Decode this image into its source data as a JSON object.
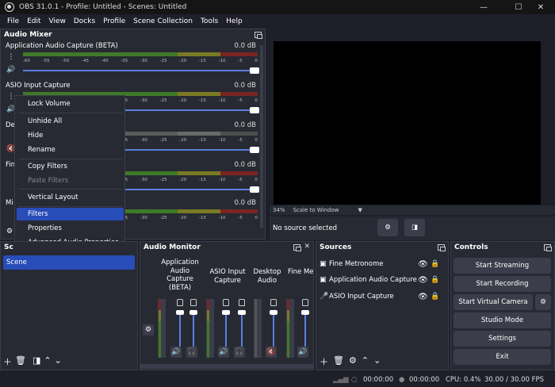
{
  "window": {
    "title": "OBS 31.0.1 - Profile: Untitled - Scenes: Untitled"
  },
  "menu": [
    "File",
    "Edit",
    "View",
    "Docks",
    "Profile",
    "Scene Collection",
    "Tools",
    "Help"
  ],
  "audio_mixer": {
    "title": "Audio Mixer",
    "ticks": [
      "-60",
      "-55",
      "-50",
      "-45",
      "-40",
      "-35",
      "-30",
      "-25",
      "-20",
      "-15",
      "-10",
      "-5",
      "0"
    ],
    "channels": [
      {
        "name": "Application Audio Capture (BETA)",
        "db": "0.0 dB"
      },
      {
        "name": "ASIO Input Capture",
        "db": "0.0 dB"
      },
      {
        "name": "De",
        "db": "0.0 dB"
      },
      {
        "name": "Fin",
        "db": "0.0 dB"
      },
      {
        "name": "Mi",
        "db": "0.0 dB"
      }
    ]
  },
  "context_menu": {
    "items": [
      {
        "label": "Lock Volume",
        "state": "normal"
      },
      {
        "label": "Unhide All",
        "state": "normal"
      },
      {
        "label": "Hide",
        "state": "normal"
      },
      {
        "label": "Rename",
        "state": "normal"
      },
      {
        "label": "Copy Filters",
        "state": "normal"
      },
      {
        "label": "Paste Filters",
        "state": "disabled"
      },
      {
        "label": "Vertical Layout",
        "state": "normal"
      },
      {
        "label": "Filters",
        "state": "selected"
      },
      {
        "label": "Properties",
        "state": "normal"
      },
      {
        "label": "Advanced Audio Properties",
        "state": "normal"
      }
    ]
  },
  "preview": {
    "zoom": "34%",
    "scale_mode": "Scale to Window",
    "no_source": "No source selected"
  },
  "scenes": {
    "title": "Sc",
    "items": [
      "Scene"
    ]
  },
  "audio_monitor": {
    "title": "Audio Monitor",
    "channels": [
      {
        "label": "Application Audio Capture (BETA)"
      },
      {
        "label": "ASIO Input Capture"
      },
      {
        "label": "Desktop Audio"
      },
      {
        "label": "Fine Metronome"
      }
    ]
  },
  "sources": {
    "title": "Sources",
    "items": [
      {
        "name": "Fine Metronome",
        "icon": "window-capture-icon"
      },
      {
        "name": "Application Audio Capture (E",
        "icon": "app-audio-icon"
      },
      {
        "name": "ASIO Input Capture",
        "icon": "microphone-icon"
      }
    ]
  },
  "controls": {
    "title": "Controls",
    "start_streaming": "Start Streaming",
    "start_recording": "Start Recording",
    "start_virtual_camera": "Start Virtual Camera",
    "studio_mode": "Studio Mode",
    "settings": "Settings",
    "exit": "Exit"
  },
  "status": {
    "stream_time": "00:00:00",
    "record_time": "00:00:00",
    "cpu": "CPU: 0.4%",
    "fps": "30.00 / 30.00 FPS"
  },
  "colors": {
    "accent": "#284cb8",
    "slider": "#5b7fe0",
    "panel": "#272a33",
    "background": "#1e1f29"
  }
}
